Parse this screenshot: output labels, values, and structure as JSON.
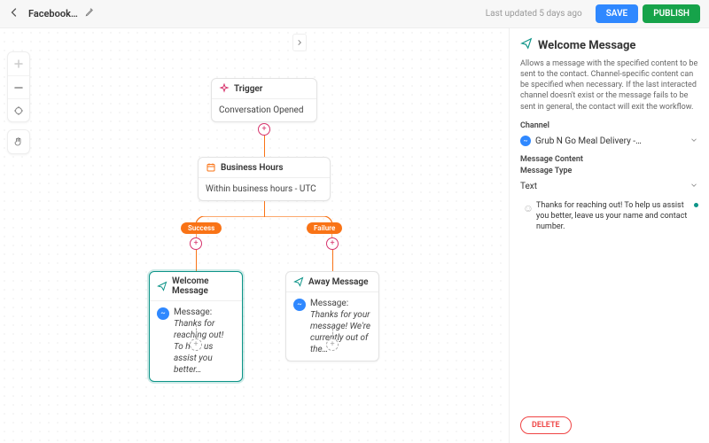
{
  "topbar": {
    "title": "Facebook…",
    "updated": "Last updated 5 days ago",
    "save": "SAVE",
    "publish": "PUBLISH"
  },
  "nodes": {
    "trigger": {
      "title": "Trigger",
      "body": "Conversation Opened"
    },
    "bh": {
      "title": "Business Hours",
      "body": "Within business hours - UTC"
    },
    "welcome": {
      "title": "Welcome Message",
      "label": "Message:",
      "body": "Thanks for reaching out! To help us assist you better…"
    },
    "away": {
      "title": "Away Message",
      "label": "Message:",
      "body": "Thanks for your message! We're currently out of the…"
    }
  },
  "pills": {
    "success": "Success",
    "failure": "Failure"
  },
  "panel": {
    "title": "Welcome Message",
    "desc": "Allows a message with the specified content to be sent to the contact. Channel-specific content can be specified when necessary. If the last interacted channel doesn't exist or the message fails to be sent in general, the contact will exit the workflow.",
    "channel_label": "Channel",
    "channel_value": "Grub N Go Meal Delivery -…",
    "content_label": "Message Content",
    "type_label": "Message Type",
    "type_value": "Text",
    "message": "Thanks for reaching out! To help us assist you better, leave us your name and contact number.",
    "delete": "DELETE"
  }
}
